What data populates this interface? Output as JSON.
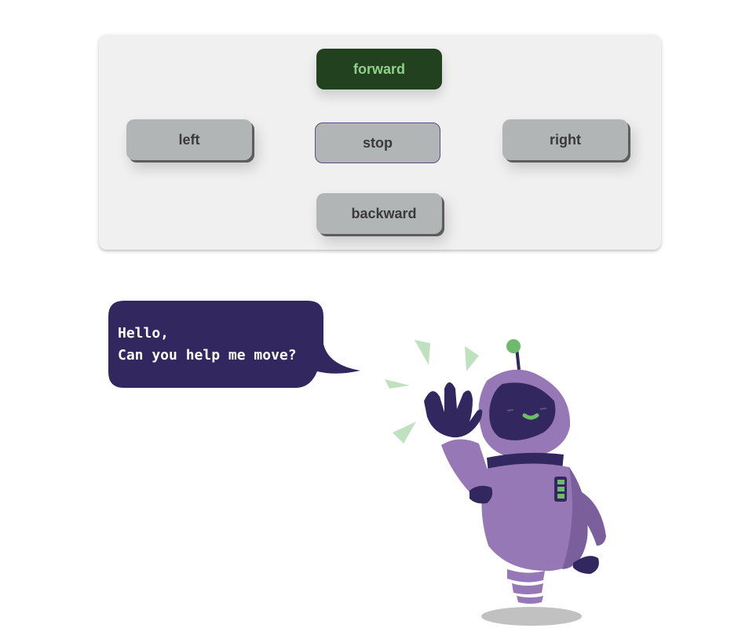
{
  "controls": {
    "forward_label": "forward",
    "left_label": "left",
    "stop_label": "stop",
    "right_label": "right",
    "backward_label": "backward"
  },
  "speech": {
    "line1": "Hello,",
    "line2": "Can you help me move?"
  },
  "colors": {
    "panel_bg": "#f0f0f0",
    "button_gray": "#b2b5b6",
    "forward_bg": "#21411f",
    "forward_text": "#8fd08a",
    "speech_bg": "#32275f",
    "robot_body": "#9678b6",
    "robot_dark": "#32275f",
    "accent_green": "#6ebc6b"
  },
  "illustration": {
    "name": "waving-robot"
  }
}
